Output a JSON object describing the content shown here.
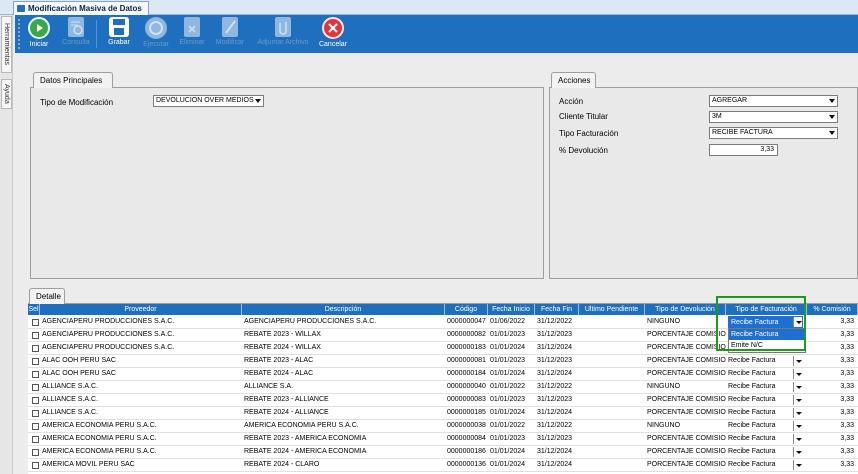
{
  "window": {
    "title": "Modificación Masiva de Datos"
  },
  "side_tabs": [
    "Herramientas",
    "Ayuda"
  ],
  "toolbar": {
    "buttons": [
      {
        "label": "Iniciar",
        "icon": "play-icon",
        "enabled": true,
        "color": "#3aa84a"
      },
      {
        "label": "Consulta",
        "icon": "query-doc-icon",
        "enabled": false,
        "color": "#8fb7df"
      },
      {
        "label": "Grabar",
        "icon": "save-icon",
        "enabled": true,
        "color": "#ffffff"
      },
      {
        "label": "Ejecutar",
        "icon": "execute-icon",
        "enabled": false,
        "color": "#8fb7df"
      },
      {
        "label": "Eliminar",
        "icon": "delete-doc-icon",
        "enabled": false,
        "color": "#8fb7df"
      },
      {
        "label": "Modificar",
        "icon": "edit-doc-icon",
        "enabled": false,
        "color": "#8fb7df"
      },
      {
        "label": "Adjuntar Archivo",
        "icon": "attach-doc-icon",
        "enabled": false,
        "color": "#8fb7df"
      },
      {
        "label": "Cancelar",
        "icon": "cancel-icon",
        "enabled": true,
        "color": "#e0363b"
      }
    ]
  },
  "datos_principales": {
    "tab": "Datos Principales",
    "tipo_modificacion_label": "Tipo de Modificación",
    "tipo_modificacion_value": "DEVOLUCION OVER MEDIOS"
  },
  "acciones": {
    "tab": "Acciones",
    "accion_label": "Acción",
    "accion_value": "AGREGAR",
    "cliente_label": "Cliente Titular",
    "cliente_value": "3M",
    "facturacion_label": "Tipo Facturación",
    "facturacion_value": "RECIBE FACTURA",
    "devolucion_label": "% Devolución",
    "devolucion_value": "3,33"
  },
  "detalle": {
    "tab": "Detalle",
    "columns": [
      "Sel",
      "Proveedor",
      "Descripción",
      "Código",
      "Fecha Inicio",
      "Fecha Fin",
      "Ultimo Pendiente",
      "Tipo de Devolución",
      "Tipo de Facturación",
      "% Comisión"
    ],
    "rows": [
      [
        "AGENCIAPERU PRODUCCIONES S.A.C.",
        "AGENCIAPERU PRODUCCIONES S.A.C.",
        "0000000047",
        "01/06/2022",
        "31/12/2022",
        "",
        "NINGUNO",
        "Recibe Factura",
        "3,33"
      ],
      [
        "AGENCIAPERU PRODUCCIONES S.A.C.",
        "REBATE 2023 - WILLAX",
        "0000000082",
        "01/01/2023",
        "31/12/2023",
        "",
        "PORCENTAJE COMISION",
        "Recibe Factura",
        "3,33"
      ],
      [
        "AGENCIAPERU PRODUCCIONES S.A.C.",
        "REBATE 2024 - WILLAX",
        "0000000183",
        "01/01/2024",
        "31/12/2024",
        "",
        "PORCENTAJE COMISION",
        "Emite N/C",
        "3,33"
      ],
      [
        "ALAC OOH PERU SAC",
        "REBATE 2023 - ALAC",
        "0000000081",
        "01/01/2023",
        "31/12/2023",
        "",
        "PORCENTAJE COMISION",
        "Recibe Factura",
        "3,33"
      ],
      [
        "ALAC OOH PERU SAC",
        "REBATE 2024 - ALAC",
        "0000000184",
        "01/01/2024",
        "31/12/2024",
        "",
        "PORCENTAJE COMISION",
        "Recibe Factura",
        "3,33"
      ],
      [
        "ALLIANCE S.A.C.",
        "ALLIANCE S.A.",
        "0000000040",
        "01/01/2022",
        "31/12/2022",
        "",
        "NINGUNO",
        "Recibe Factura",
        "3,33"
      ],
      [
        "ALLIANCE S.A.C.",
        "REBATE 2023 - ALLIANCE",
        "0000000083",
        "01/01/2023",
        "31/12/2023",
        "",
        "PORCENTAJE COMISION",
        "Recibe Factura",
        "3,33"
      ],
      [
        "ALLIANCE S.A.C.",
        "REBATE 2024 - ALLIANCE",
        "0000000185",
        "01/01/2024",
        "31/12/2024",
        "",
        "PORCENTAJE COMISION",
        "Recibe Factura",
        "3,33"
      ],
      [
        "AMERICA ECONOMIA PERU S.A.C.",
        "AMERICA ECONOMIA PERU S.A.C.",
        "0000000038",
        "01/01/2022",
        "31/12/2022",
        "",
        "NINGUNO",
        "Recibe Factura",
        "3,33"
      ],
      [
        "AMERICA ECONOMIA PERU S.A.C.",
        "REBATE 2023 -  AMERICA ECONOMIA",
        "0000000084",
        "01/01/2023",
        "31/12/2023",
        "",
        "PORCENTAJE COMISION",
        "Recibe Factura",
        "3,33"
      ],
      [
        "AMERICA ECONOMIA PERU S.A.C.",
        "REBATE 2024 - AMERICA ECONOMIA",
        "0000000186",
        "01/01/2024",
        "31/12/2024",
        "",
        "PORCENTAJE COMISION",
        "Recibe Factura",
        "3,33"
      ],
      [
        "AMERICA MOVIL PERU SAC",
        "REBATE 2024 - CLARO",
        "0000000136",
        "01/01/2024",
        "31/12/2024",
        "",
        "PORCENTAJE COMISION",
        "Recibe Factura",
        "3,33"
      ]
    ],
    "dropdown": {
      "current": "Recibe Factura",
      "options": [
        "Recibe Factura",
        "Emite N/C"
      ]
    }
  },
  "colors": {
    "accent": "#1e70be",
    "highlight": "#1d9a1d",
    "selection": "#1e6fd0"
  }
}
